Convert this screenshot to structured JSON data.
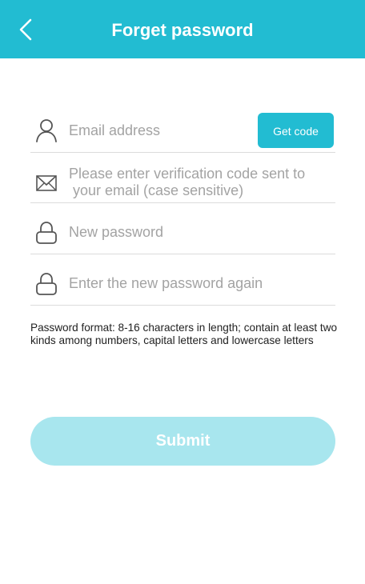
{
  "header": {
    "title": "Forget password",
    "back_icon": "chevron-left-icon",
    "background_color": "#22bcd2"
  },
  "form": {
    "email": {
      "placeholder": "Email address",
      "icon": "user-icon",
      "get_code_label": "Get code"
    },
    "code": {
      "placeholder": "Please enter verification code sent to\n your email (case sensitive)",
      "icon": "envelope-icon"
    },
    "new_password": {
      "placeholder": "New password",
      "icon": "lock-icon"
    },
    "confirm_password": {
      "placeholder": "Enter the new password again",
      "icon": "lock-icon"
    },
    "hint": "Password format: 8-16 characters in length; contain at least two kinds among numbers, capital letters and lowercase letters",
    "submit_label": "Submit"
  },
  "colors": {
    "accent": "#22bcd2",
    "submit_disabled": "#a8e6ee",
    "placeholder": "#a3a3a3",
    "divider": "#dcdcdc"
  }
}
